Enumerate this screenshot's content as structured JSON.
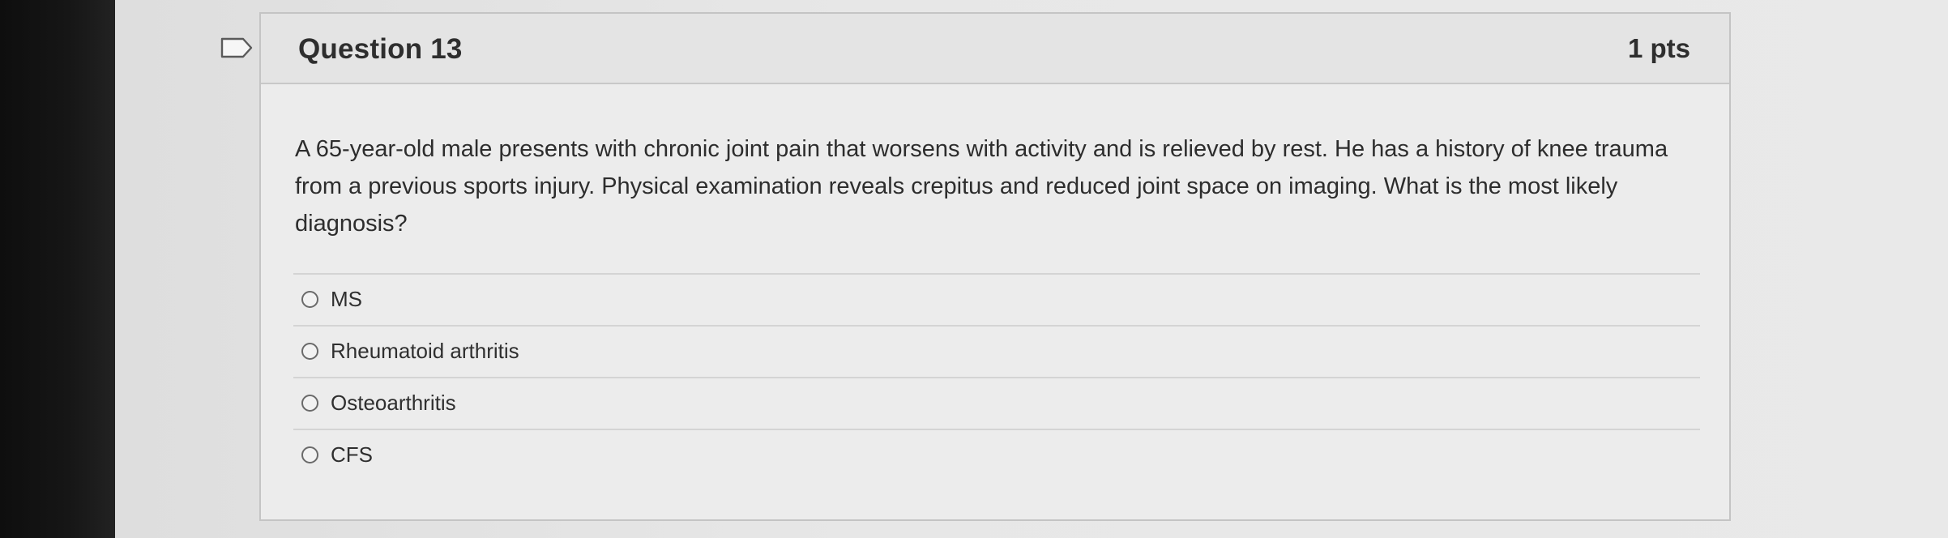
{
  "question": {
    "title": "Question 13",
    "points": "1 pts",
    "text": "A 65-year-old male presents with chronic joint pain that worsens with activity and is relieved by rest. He has a history of knee trauma from a previous sports injury. Physical examination reveals crepitus and reduced joint space on imaging. What is the most likely diagnosis?",
    "answers": [
      {
        "label": "MS",
        "selected": false
      },
      {
        "label": "Rheumatoid arthritis",
        "selected": false
      },
      {
        "label": "Osteoarthritis",
        "selected": false
      },
      {
        "label": "CFS",
        "selected": false
      }
    ]
  },
  "icons": {
    "flag": "flag-question-icon",
    "radio": "radio-unchecked-icon"
  }
}
